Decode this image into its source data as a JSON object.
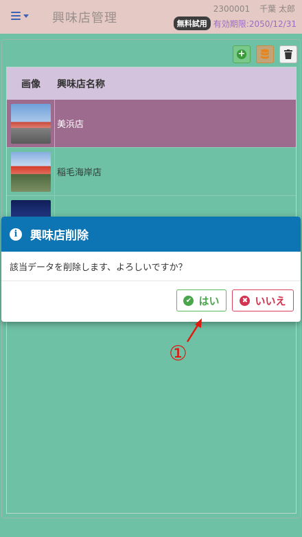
{
  "header": {
    "title": "興味店管理",
    "user_id": "2300001",
    "user_name": "千葉 太郎",
    "trial_badge": "無料試用",
    "expiry": "有効期限:2050/12/31",
    "menu_icon": "hamburger-menu-icon"
  },
  "toolbar": {
    "add_icon": "plus-circle-icon",
    "db_icon": "database-icon",
    "delete_icon": "trash-icon"
  },
  "table": {
    "columns": [
      "画像",
      "興味店名称"
    ],
    "rows": [
      {
        "name": "美浜店",
        "selected": true
      },
      {
        "name": "稲毛海岸店",
        "selected": false
      },
      {
        "name": "",
        "selected": false
      }
    ]
  },
  "dialog": {
    "title": "興味店削除",
    "message": "該当データを削除します、よろしいですか？",
    "yes_label": "はい",
    "no_label": "いいえ",
    "icon": "info-icon"
  },
  "annotation": {
    "label": "①"
  },
  "colors": {
    "background": "#6fc1a5",
    "header": "#e4c9c4",
    "dialog_header": "#0e75b5",
    "selected_row": "#9d6b8d",
    "yes": "#4aa64a",
    "no": "#d23350",
    "annotation": "#e0190f"
  }
}
